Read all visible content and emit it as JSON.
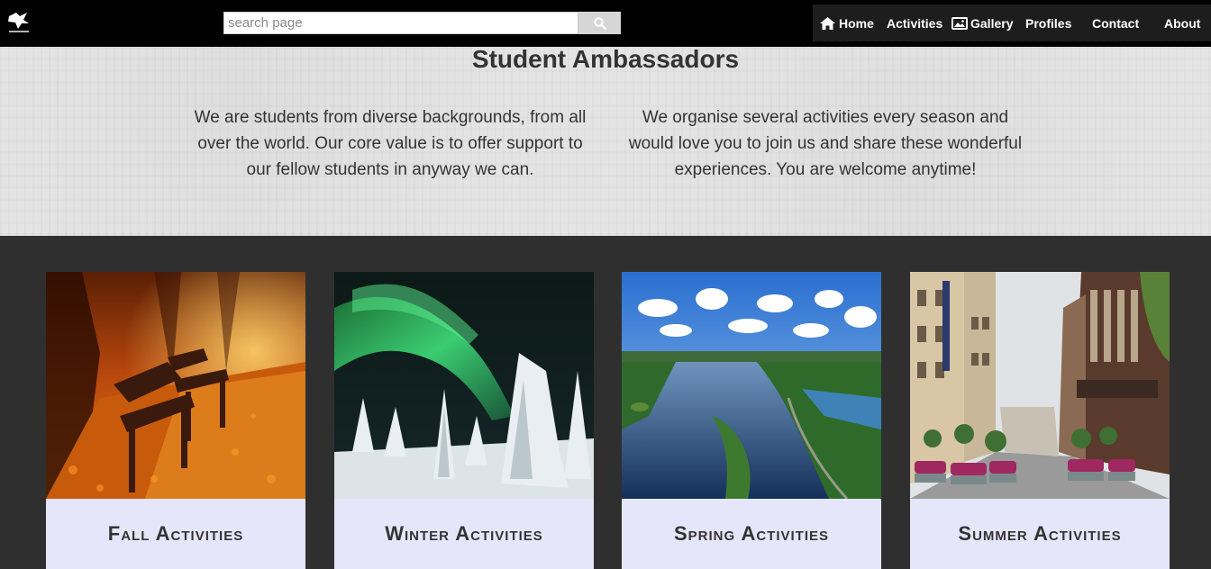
{
  "search": {
    "placeholder": "search page"
  },
  "nav": {
    "home": "Home",
    "activities": "Activities",
    "gallery": "Gallery",
    "profiles": "Profiles",
    "contact": "Contact",
    "about": "About"
  },
  "hero": {
    "title": "Student Ambassadors",
    "left_text": "We are students from diverse backgrounds, from all over the world. Our core value is to offer support to our fellow students in anyway we can.",
    "right_text": "We organise several activities every season and would love you to join us and share these wonderful experiences. You are welcome anytime!"
  },
  "cards": [
    {
      "label": "Fall Activities",
      "image": "autumn-park-benches"
    },
    {
      "label": "Winter Activities",
      "image": "aurora-snowy-trees"
    },
    {
      "label": "Spring Activities",
      "image": "aerial-lake-view"
    },
    {
      "label": "Summer Activities",
      "image": "city-street"
    }
  ],
  "colors": {
    "topbar": "#000000",
    "hero_bg": "#e7e7e7",
    "section_bg": "#2f2f2f",
    "card_label_bg": "#e6e6fa"
  }
}
